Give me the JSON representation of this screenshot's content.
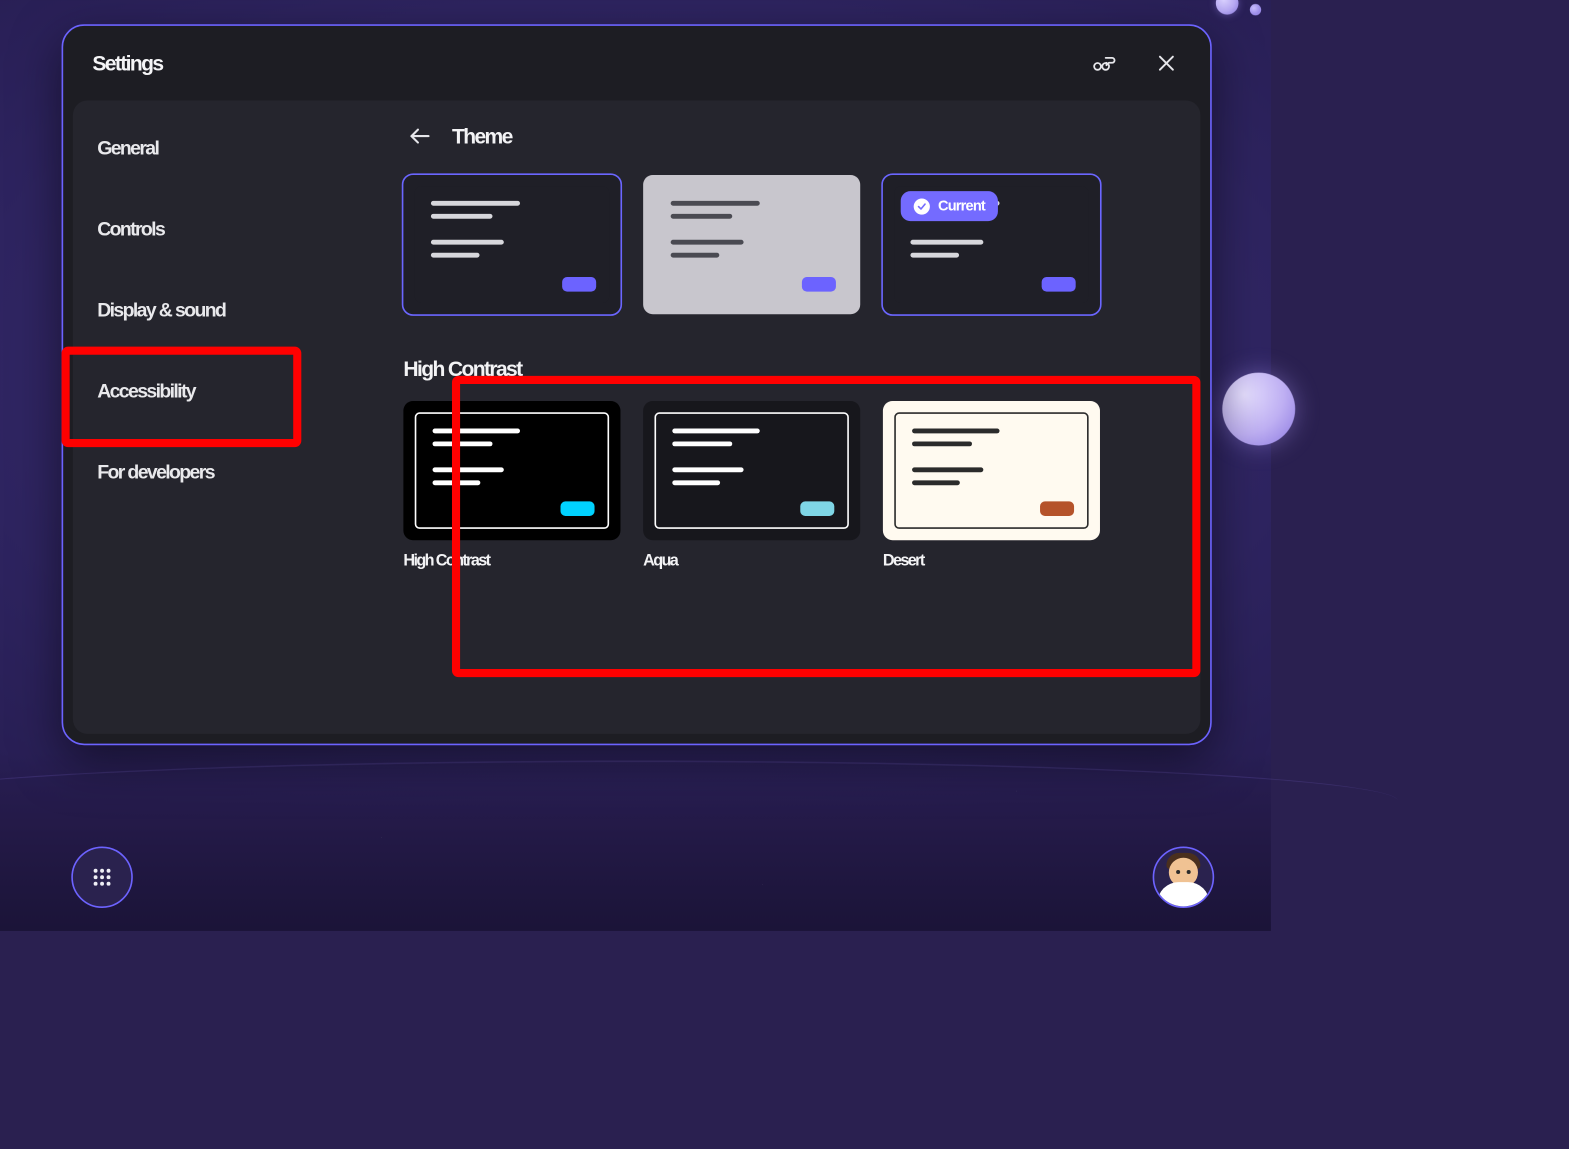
{
  "window": {
    "title": "Settings",
    "feedback_icon": "feedback-icon",
    "close_icon": "close-icon"
  },
  "sidebar": {
    "items": [
      {
        "label": "General"
      },
      {
        "label": "Controls"
      },
      {
        "label": "Display & sound"
      },
      {
        "label": "Accessibility"
      },
      {
        "label": "For developers"
      }
    ],
    "active_index": 3
  },
  "content": {
    "title": "Theme",
    "back_icon": "arrow-left-icon",
    "current_badge": "Current",
    "themes_row1": [
      {
        "bg": "#1f1f27",
        "inner_bg": "#1f1f27",
        "line_color": "#d7d7dc",
        "accent": "#6c63ff",
        "selected": true
      },
      {
        "bg": "#c8c6cd",
        "inner_bg": "#c8c6cd",
        "line_color": "#4a4a52",
        "accent": "#6c63ff",
        "selected": false
      },
      {
        "bg": "#1f1f27",
        "inner_bg": "#1f1f27",
        "line_color": "#d7d7dc",
        "accent": "#6c63ff",
        "selected": true,
        "is_current": true
      }
    ],
    "high_contrast_title": "High Contrast",
    "high_contrast_themes": [
      {
        "name": "High Contrast",
        "bg": "#000000",
        "inner_border": "#ffffff",
        "line_color": "#ffffff",
        "accent": "#00d2ff"
      },
      {
        "name": "Aqua",
        "bg": "#17171c",
        "inner_border": "#ffffff",
        "line_color": "#ffffff",
        "accent": "#7fd6e6"
      },
      {
        "name": "Desert",
        "bg": "#fffaf0",
        "inner_border": "#2b2b2b",
        "line_color": "#2b2b2b",
        "accent": "#b5532a"
      }
    ]
  },
  "bottom": {
    "apps_icon": "apps-grid-icon",
    "avatar_icon": "avatar-icon"
  },
  "annotations": {
    "sidebar_item": "Accessibility",
    "section": "High Contrast"
  }
}
